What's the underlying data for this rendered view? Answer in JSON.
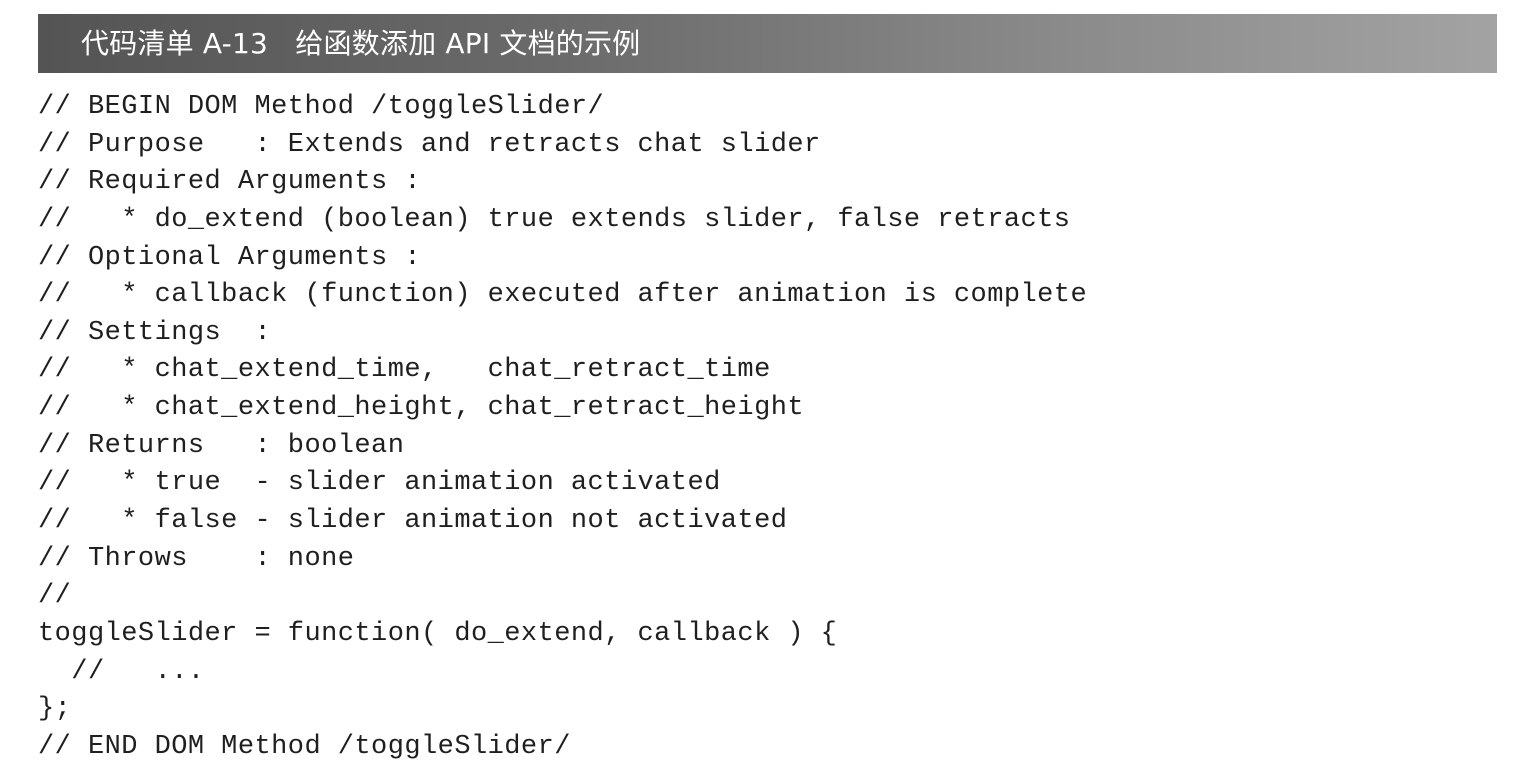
{
  "listing": {
    "title": "代码清单 A-13   给函数添加 API 文档的示例"
  },
  "code": {
    "lines": [
      "// BEGIN DOM Method /toggleSlider/",
      "// Purpose   : Extends and retracts chat slider",
      "// Required Arguments :",
      "//   * do_extend (boolean) true extends slider, false retracts",
      "// Optional Arguments :",
      "//   * callback (function) executed after animation is complete",
      "// Settings  :",
      "//   * chat_extend_time,   chat_retract_time",
      "//   * chat_extend_height, chat_retract_height",
      "// Returns   : boolean",
      "//   * true  - slider animation activated",
      "//   * false - slider animation not activated",
      "// Throws    : none",
      "//",
      "toggleSlider = function( do_extend, callback ) {",
      "  //   ...",
      "};",
      "// END DOM Method /toggleSlider/"
    ]
  }
}
